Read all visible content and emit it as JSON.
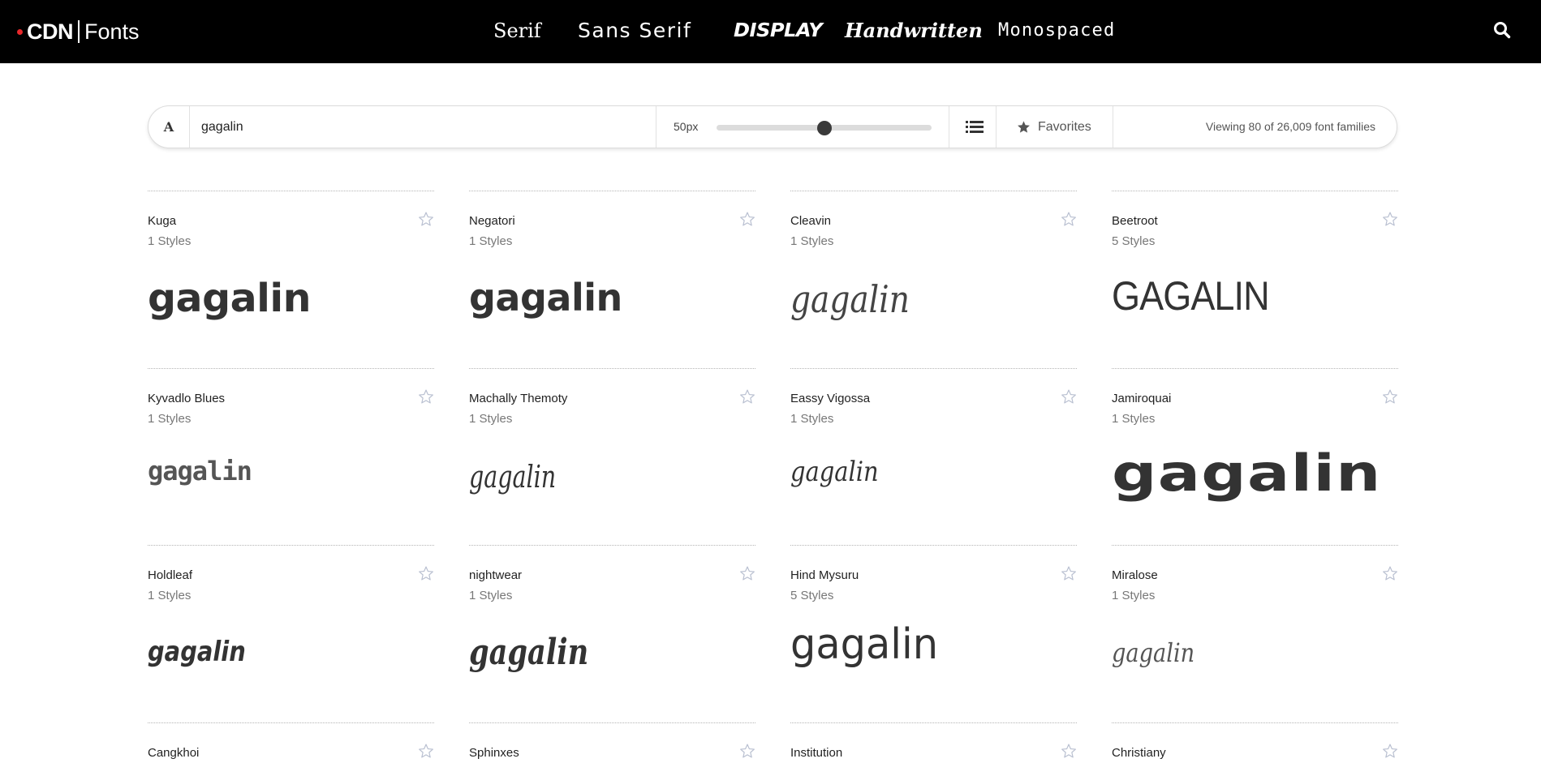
{
  "header": {
    "logo": {
      "brand": "CDN",
      "product": "Fonts"
    },
    "nav": [
      {
        "label": "Serif"
      },
      {
        "label": "Sans Serif"
      },
      {
        "label": "DISPLAY"
      },
      {
        "label": "Handwritten"
      },
      {
        "label": "Monospaced"
      }
    ],
    "search_icon": "search-icon"
  },
  "toolbar": {
    "font_icon_glyph": "A",
    "preview_text": "gagalin",
    "size_label": "50px",
    "size_slider_fraction": 0.5,
    "list_icon": "list-view-icon",
    "favorites_label": "Favorites",
    "count_text": "Viewing 80 of 26,009 font families"
  },
  "fonts": [
    {
      "name": "Kuga",
      "styles": "1 Styles",
      "preview": "gagalin"
    },
    {
      "name": "Negatori",
      "styles": "1 Styles",
      "preview": "gagalin"
    },
    {
      "name": "Cleavin",
      "styles": "1 Styles",
      "preview": "gagalin"
    },
    {
      "name": "Beetroot",
      "styles": "5 Styles",
      "preview": "GAGALIN"
    },
    {
      "name": "Kyvadlo Blues",
      "styles": "1 Styles",
      "preview": "gagalin"
    },
    {
      "name": "Machally Themoty",
      "styles": "1 Styles",
      "preview": "gagalin"
    },
    {
      "name": "Eassy Vigossa",
      "styles": "1 Styles",
      "preview": "gagalin"
    },
    {
      "name": "Jamiroquai",
      "styles": "1 Styles",
      "preview": "gagalin"
    },
    {
      "name": "Holdleaf",
      "styles": "1 Styles",
      "preview": "gagalin"
    },
    {
      "name": "nightwear",
      "styles": "1 Styles",
      "preview": "gagalin"
    },
    {
      "name": "Hind Mysuru",
      "styles": "5 Styles",
      "preview": "gagalin"
    },
    {
      "name": "Miralose",
      "styles": "1 Styles",
      "preview": "gagalin"
    },
    {
      "name": "Cangkhoi"
    },
    {
      "name": "Sphinxes"
    },
    {
      "name": "Institution"
    },
    {
      "name": "Christiany"
    }
  ],
  "colors": {
    "header_bg": "#000000",
    "logo_dot": "#e8282b",
    "slider_thumb": "#3a3a3a",
    "star_outline": "#b8bfd0"
  }
}
